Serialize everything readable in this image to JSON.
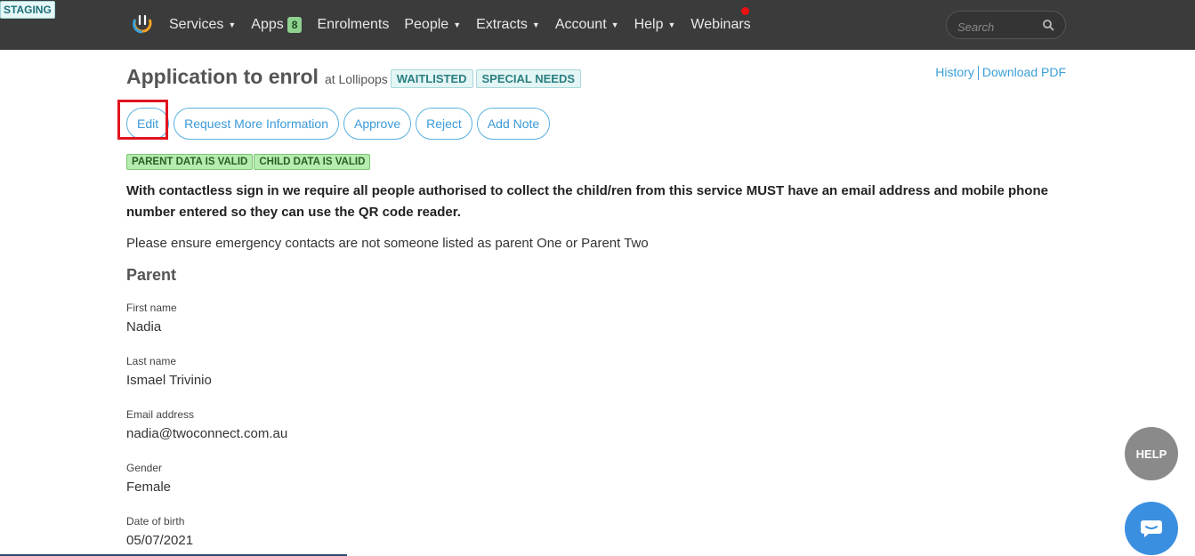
{
  "env_badge": "STAGING",
  "nav": {
    "items": [
      {
        "label": "Services",
        "caret": true
      },
      {
        "label": "Apps",
        "badge": "8",
        "caret": false
      },
      {
        "label": "Enrolments",
        "caret": false
      },
      {
        "label": "People",
        "caret": true
      },
      {
        "label": "Extracts",
        "caret": true
      },
      {
        "label": "Account",
        "caret": true
      },
      {
        "label": "Help",
        "caret": true
      },
      {
        "label": "Webinars",
        "caret": false
      }
    ],
    "search_placeholder": "Search"
  },
  "page": {
    "title": "Application to enrol",
    "location_prefix": "at Lollipops",
    "tags": [
      "WAITLISTED",
      "SPECIAL NEEDS"
    ],
    "links": {
      "history": "History",
      "download": "Download PDF"
    }
  },
  "actions": [
    "Edit",
    "Request More Information",
    "Approve",
    "Reject",
    "Add Note"
  ],
  "validation": [
    "PARENT DATA IS VALID",
    "CHILD DATA IS VALID"
  ],
  "notice": "With contactless sign in we require all people authorised to collect the child/ren from this service MUST have an email address and mobile phone number entered so they can use the QR code reader.",
  "info": "Please ensure emergency contacts are not someone listed as parent One or Parent Two",
  "section": "Parent",
  "fields": [
    {
      "label": "First name",
      "value": "Nadia"
    },
    {
      "label": "Last name",
      "value": "Ismael Trivinio"
    },
    {
      "label": "Email address",
      "value": "nadia@twoconnect.com.au"
    },
    {
      "label": "Gender",
      "value": "Female"
    },
    {
      "label": "Date of birth",
      "value": "05/07/2021"
    }
  ],
  "help_label": "HELP",
  "colors": {
    "navbar": "#3b3b3b",
    "accent": "#3b9fd8",
    "valid": "#b6ecb0",
    "tag": "#e3f5f5",
    "highlight": "#e0141e"
  }
}
